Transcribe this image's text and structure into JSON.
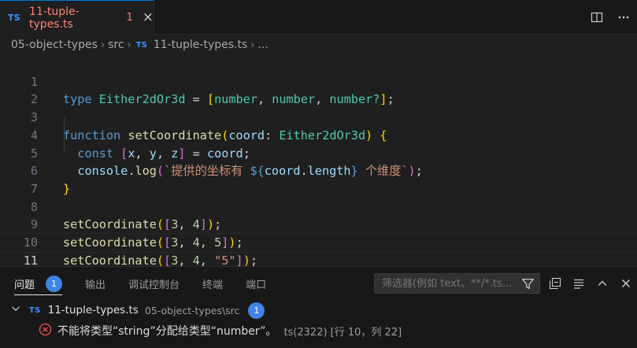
{
  "tab": {
    "lang_badge": "TS",
    "title": "11-tuple-types.ts",
    "problem_count": "1",
    "close_glyph": "×"
  },
  "breadcrumb": {
    "items": [
      "05-object-types",
      "src"
    ],
    "file_badge": "TS",
    "file": "11-tuple-types.ts",
    "trail": "..."
  },
  "editor": {
    "line_numbers": [
      "1",
      "2",
      "3",
      "4",
      "5",
      "6",
      "7",
      "8",
      "9",
      "10",
      "11"
    ],
    "active_line": "11",
    "lines": {
      "l1": {
        "kw": "type",
        "name": "Either2dOr3d",
        "eq": " = ",
        "open": "[",
        "t1": "number",
        "c1": ", ",
        "t2": "number",
        "c2": ", ",
        "t3": "number?",
        "close": "]",
        "end": ";"
      },
      "l3": {
        "kw": "function",
        "fn": "setCoordinate",
        "open": "(",
        "param": "coord",
        "colon": ": ",
        "ptype": "Either2dOr3d",
        "close": ")",
        "brace": " {"
      },
      "l4": {
        "kw": "const",
        "open": "[",
        "x": "x",
        "c1": ", ",
        "y": "y",
        "c2": ", ",
        "z": "z",
        "close": "]",
        "eq": " = ",
        "rhs": "coord",
        "end": ";"
      },
      "l5": {
        "obj": "console",
        "dot": ".",
        "fn": "log",
        "open": "(",
        "tpl_start": "`提供的坐标有 ",
        "interp_open": "${",
        "obj2": "coord",
        "dot2": ".",
        "prop": "length",
        "interp_close": "}",
        "tpl_end": " 个维度`",
        "close": ")",
        "end": ";"
      },
      "l7": {
        "brace": "}"
      },
      "l9": {
        "fn": "setCoordinate",
        "open": "(",
        "aopen": "[",
        "a": "3",
        "c1": ", ",
        "b": "4",
        "aclose": "]",
        "close": ")",
        "end": ";"
      },
      "l10": {
        "fn": "setCoordinate",
        "open": "(",
        "aopen": "[",
        "a": "3",
        "c1": ", ",
        "b": "4",
        "c2": ", ",
        "c": "5",
        "aclose": "]",
        "close": ")",
        "end": ";"
      },
      "l11": {
        "fn": "setCoordinate",
        "open": "(",
        "aopen": "[",
        "a": "3",
        "c1": ", ",
        "b": "4",
        "c2": ", ",
        "c": "\"5\"",
        "aclose": "]",
        "close": ")",
        "end": ";"
      }
    }
  },
  "panel": {
    "tabs": [
      {
        "label": "问题",
        "badge": "1"
      },
      {
        "label": "输出"
      },
      {
        "label": "调试控制台"
      },
      {
        "label": "终端"
      },
      {
        "label": "端口"
      }
    ],
    "filter_placeholder": "筛选器(例如 text、**/*.ts...",
    "file_row": {
      "badge": "TS",
      "name": "11-tuple-types.ts",
      "path": "05-object-types\\src",
      "count": "1"
    },
    "error": {
      "message": "不能将类型“string”分配给类型“number”。",
      "source": "ts(2322)  [行 10，列 22]"
    }
  },
  "colors": {
    "accent": "#0078d4",
    "error": "#f14c4c",
    "badge": "#3f84e5",
    "ts_icon": "#3794ff",
    "tab_error_text": "#f48771"
  },
  "icons": [
    "close-icon",
    "split-editor-icon",
    "more-actions-icon",
    "chevron-right-icon",
    "filter-icon",
    "collapse-all-icon",
    "view-as-list-icon",
    "maximize-panel-icon",
    "close-panel-icon",
    "chevron-down-icon",
    "error-icon"
  ]
}
